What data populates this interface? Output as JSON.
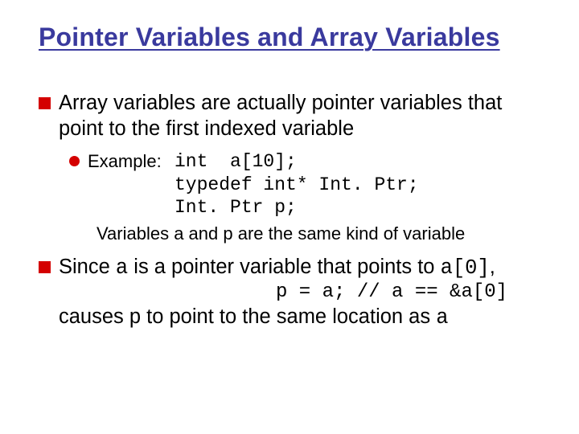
{
  "title": "Pointer Variables and Array Variables",
  "point1": "Array variables are actually pointer variables that point to the first indexed variable",
  "example": {
    "label": "Example:",
    "code1": "int  a[10];",
    "code2": "typedef int* Int. Ptr;",
    "code3": "Int. Ptr p;",
    "note": "Variables a and p are the same kind of variable"
  },
  "point2": {
    "line1a": "Since ",
    "line1b": "a",
    "line1c": " is a pointer variable that points to ",
    "line1d": "a[0]",
    "line1e": ",",
    "code": "p = a; // a == &a[0]",
    "line3a": "causes p to point to the same location as ",
    "line3b": "a"
  }
}
